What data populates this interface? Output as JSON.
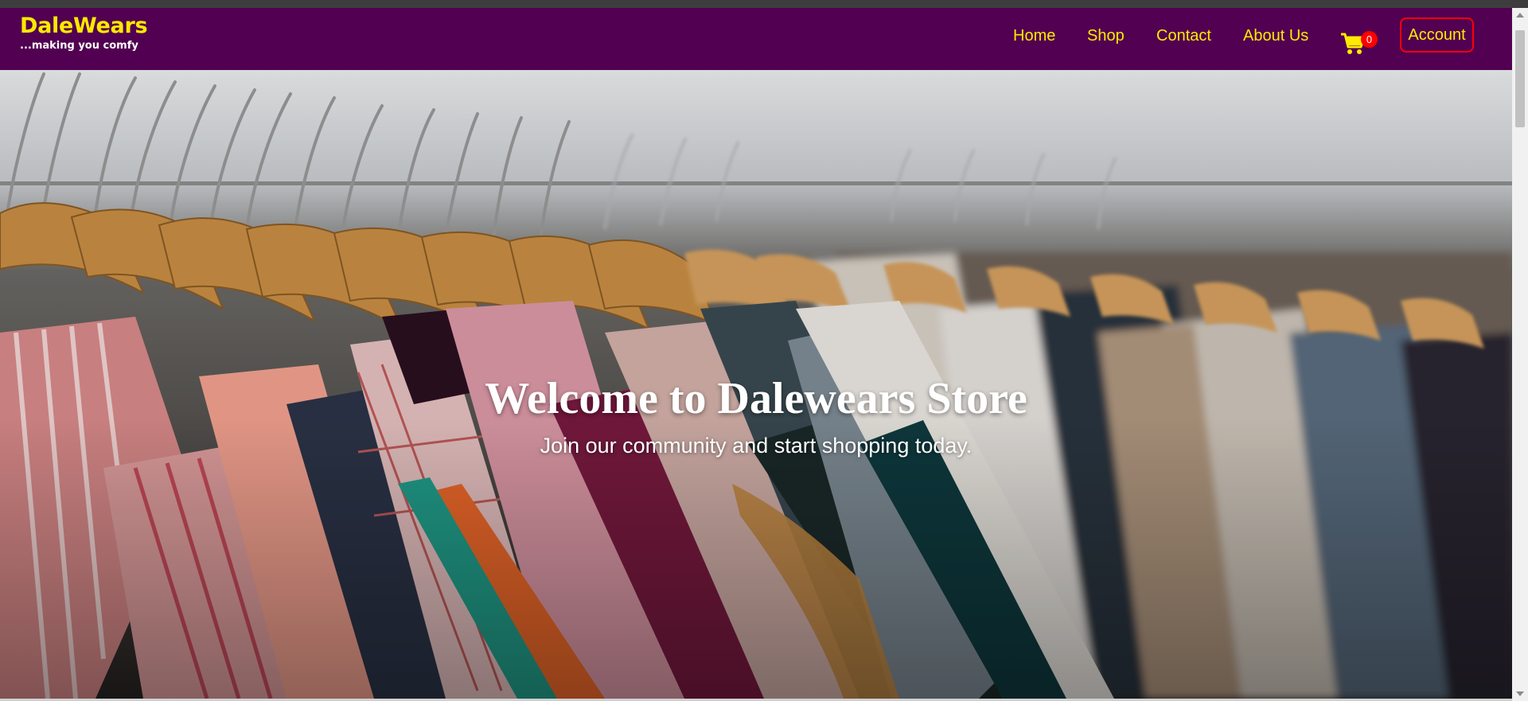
{
  "brand": {
    "name": "DaleWears",
    "tagline": "...making you comfy"
  },
  "nav": {
    "links": [
      "Home",
      "Shop",
      "Contact",
      "About Us"
    ],
    "cart": {
      "icon": "shopping-cart-icon",
      "count": "0"
    },
    "account_label": "Account"
  },
  "hero": {
    "title": "Welcome to Dalewears Store",
    "subtitle": "Join our community and start shopping today."
  },
  "colors": {
    "navbar_bg": "#520051",
    "brand_yellow": "#ffe900",
    "accent_red": "#ff0000",
    "hero_text": "#ffffff"
  }
}
